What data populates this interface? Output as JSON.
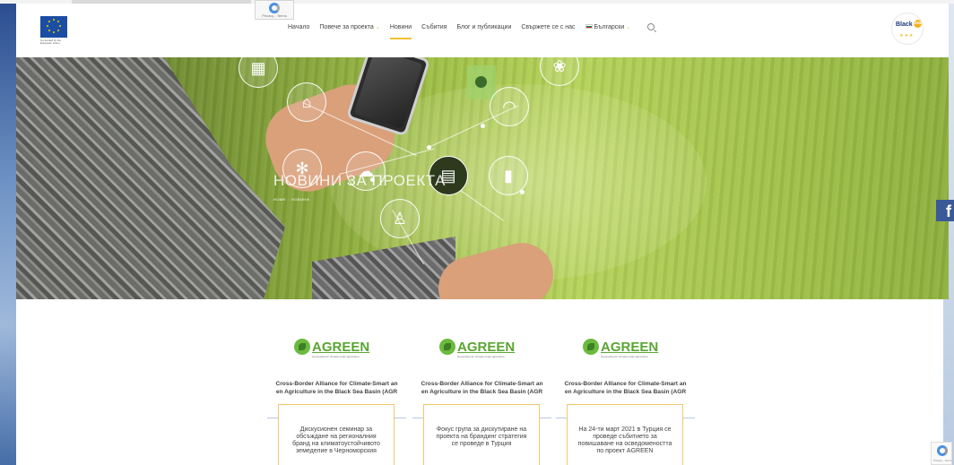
{
  "recaptcha": {
    "top_label": "Privacy - Terms",
    "bottom_label": "Privacy - Terms"
  },
  "eu_caption": "Co-funded by the European Union",
  "nav": {
    "items": [
      {
        "label": "Начало",
        "active": false,
        "caret": false
      },
      {
        "label": "Повече за проекта",
        "active": false,
        "caret": true
      },
      {
        "label": "Новини",
        "active": true,
        "caret": false
      },
      {
        "label": "Събития",
        "active": false,
        "caret": false
      },
      {
        "label": "Блог и публикации",
        "active": false,
        "caret": false
      },
      {
        "label": "Свържете се с нас",
        "active": false,
        "caret": false
      }
    ],
    "language": "Български",
    "search_icon": "search-icon"
  },
  "brand_logo": {
    "line1": "Black",
    "line2": "Sea"
  },
  "hero": {
    "title": "НОВИНИ ЗА ПРОЕКТА",
    "breadcrumb_home": "HOME",
    "breadcrumb_current": "НОВИНИ"
  },
  "social": {
    "facebook": "f"
  },
  "cards": [
    {
      "brand": "AGREEN",
      "brand_sub": "Generating for climate-smart agriculture",
      "title_line1": "Cross-Border Alliance for Climate-Smart an",
      "title_line2": "en Agriculture in the Black Sea Basin (AGR",
      "excerpt": "Дискусионен семинар за обсъждане на регионалния бранд на климатоустойчивото земеделие в Черноморския"
    },
    {
      "brand": "AGREEN",
      "brand_sub": "Generating for climate-smart agriculture",
      "title_line1": "Cross-Border Alliance for Climate-Smart an",
      "title_line2": "en Agriculture in the Black Sea Basin (AGR",
      "excerpt": "Фокус група за дискутиране на проекта на брандинг стратегия се проведе в Турция"
    },
    {
      "brand": "AGREEN",
      "brand_sub": "Generating for climate-smart agriculture",
      "title_line1": "Cross-Border Alliance for Climate-Smart an",
      "title_line2": "en Agriculture in the Black Sea Basin (AGR",
      "excerpt": "На 24-ти март 2021 в Турция се проведе събитието за повишаване на осведомеността по проект AGREEN"
    }
  ],
  "colors": {
    "accent": "#f2c230",
    "brand_green": "#5aa532",
    "facebook": "#3b5998"
  }
}
